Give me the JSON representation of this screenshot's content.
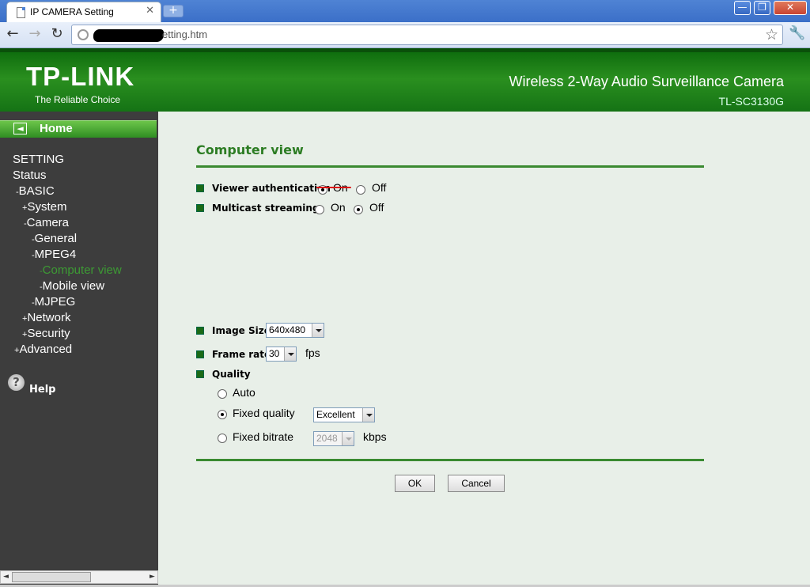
{
  "browser": {
    "tab_title": "IP CAMERA Setting",
    "tab_close": "✕",
    "new_tab": "+",
    "url_visible": "etting.htm",
    "win_min": "—",
    "win_max": "❐",
    "win_close": "✕",
    "back": "←",
    "forward": "→",
    "reload": "↻",
    "bookmark_star": "☆",
    "wrench": "🔧"
  },
  "banner": {
    "logo": "TP-LINK",
    "tagline": "The Reliable Choice",
    "product": "Wireless 2-Way Audio Surveillance Camera",
    "model": "TL-SC3130G"
  },
  "sidebar": {
    "home": "Home",
    "home_icon": "◄",
    "items": [
      {
        "prefix": "",
        "label": "SETTING"
      },
      {
        "prefix": "",
        "label": "Status"
      },
      {
        "prefix": "-",
        "label": "BASIC"
      },
      {
        "prefix": "+",
        "label": "System"
      },
      {
        "prefix": "-",
        "label": "Camera"
      },
      {
        "prefix": "-",
        "label": "General"
      },
      {
        "prefix": "-",
        "label": "MPEG4"
      },
      {
        "prefix": "-",
        "label": "Computer view"
      },
      {
        "prefix": "-",
        "label": "Mobile view"
      },
      {
        "prefix": "-",
        "label": "MJPEG"
      },
      {
        "prefix": "+",
        "label": "Network"
      },
      {
        "prefix": "+",
        "label": "Security"
      },
      {
        "prefix": "+",
        "label": "Advanced"
      }
    ],
    "help_icon": "?",
    "help": "Help",
    "scroll_left": "◄",
    "scroll_right": "►"
  },
  "content": {
    "heading": "Computer view",
    "viewer_auth": {
      "label": "Viewer authentication",
      "on": "On",
      "off": "Off",
      "selected": "On"
    },
    "multicast": {
      "label": "Multicast streaming",
      "on": "On",
      "off": "Off",
      "selected": "Off"
    },
    "image_size": {
      "label": "Image Size",
      "value": "640x480"
    },
    "frame_rate": {
      "label": "Frame rate",
      "value": "30",
      "unit": "fps"
    },
    "quality": {
      "label": "Quality",
      "auto": "Auto",
      "fixed_quality": "Fixed quality",
      "fixed_quality_value": "Excellent",
      "fixed_bitrate": "Fixed bitrate",
      "bitrate_value": "2048",
      "bitrate_unit": "kbps",
      "selected": "Fixed quality"
    },
    "ok": "OK",
    "cancel": "Cancel"
  }
}
